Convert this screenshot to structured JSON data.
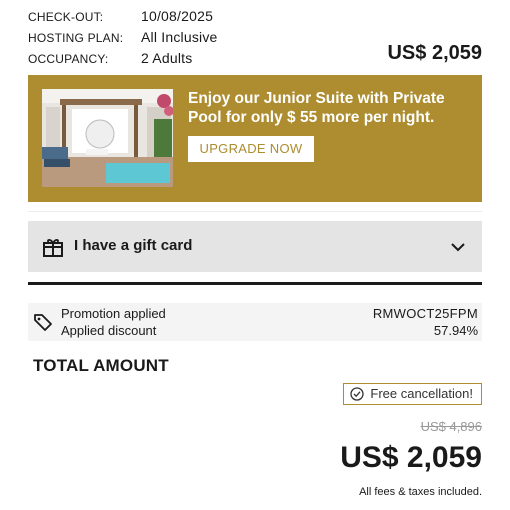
{
  "summary": {
    "rows": [
      {
        "label": "CHECK-OUT:",
        "value": "10/08/2025"
      },
      {
        "label": "HOSTING PLAN:",
        "value": "All Inclusive"
      },
      {
        "label": "OCCUPANCY:",
        "value": "2 Adults"
      }
    ],
    "price": "US$ 2,059"
  },
  "upsell": {
    "title": "Enjoy our Junior Suite with Private Pool for only $ 55 more per night.",
    "button_label": "UPGRADE NOW",
    "background_color": "#ad8d2f"
  },
  "gift_card": {
    "label": "I have a gift card",
    "icon": "gift-icon"
  },
  "promotion": {
    "applied_label": "Promotion applied",
    "discount_label": "Applied discount",
    "code": "RMWOCT25FPM",
    "discount": "57.94%",
    "icon": "tag-icon"
  },
  "total": {
    "label": "TOTAL AMOUNT",
    "free_cancellation": "Free cancellation!",
    "original_price": "US$ 4,896",
    "price": "US$ 2,059",
    "fees_note": "All fees & taxes included."
  }
}
